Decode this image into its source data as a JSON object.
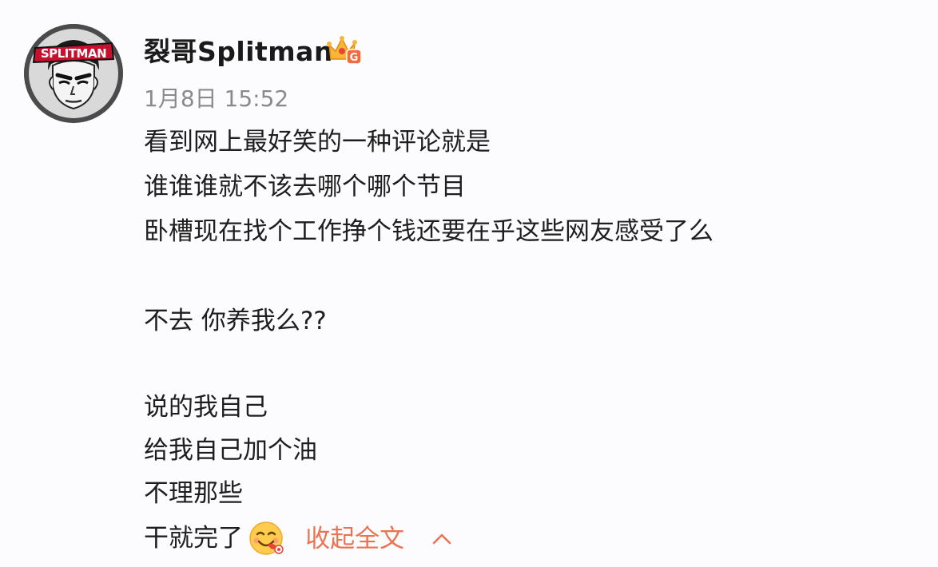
{
  "author": {
    "name": "裂哥Splitman",
    "avatar_text": "SPLITMAN",
    "badge_letter": "G",
    "avatar_icon": "splitman-avatar-icon",
    "badge_icon": "crown-vip-badge-icon"
  },
  "post": {
    "timestamp": "1月8日 15:52",
    "lines": [
      "看到网上最好笑的一种评论就是",
      "谁谁谁就不该去哪个哪个节目",
      "卧槽现在找个工作挣个钱还要在乎这些网友感受了么",
      "不去 你养我么??",
      "说的我自己",
      "给我自己加个油",
      "不理那些",
      "干就完了"
    ],
    "emoji_icon": "yummy-face-emoji-icon",
    "collapse_label": "收起全文",
    "collapse_icon": "chevron-up-icon"
  },
  "colors": {
    "accent": "#eb7350",
    "timestamp": "#8a8a8a",
    "text": "#1e1e1e",
    "background": "#fcfcfe"
  }
}
